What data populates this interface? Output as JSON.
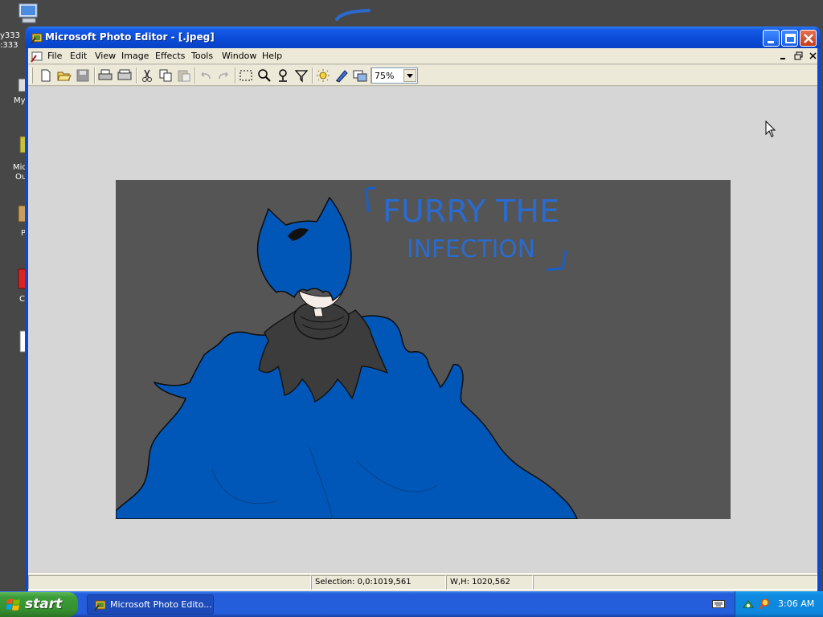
{
  "desktop": {
    "icon_labels": [
      "y333",
      ":333",
      "My",
      "Mic",
      "Ou",
      "P",
      "C"
    ]
  },
  "window": {
    "title": "Microsoft Photo Editor - [.jpeg]",
    "menu": [
      "File",
      "Edit",
      "View",
      "Image",
      "Effects",
      "Tools",
      "Window",
      "Help"
    ],
    "zoom_value": "75%",
    "image_text_line1": "FURRY THE",
    "image_text_line2": "INFECTION",
    "status": {
      "selection": "Selection: 0,0:1019,561",
      "size": "W,H: 1020,562"
    }
  },
  "taskbar": {
    "start_label": "start",
    "task_label": "Microsoft Photo Edito...",
    "clock": "3:06 AM"
  },
  "colors": {
    "title_blue": "#0a4bd6",
    "xp_green": "#36912f",
    "drawing_blue": "#0057b8",
    "drawing_bg": "#555555"
  }
}
